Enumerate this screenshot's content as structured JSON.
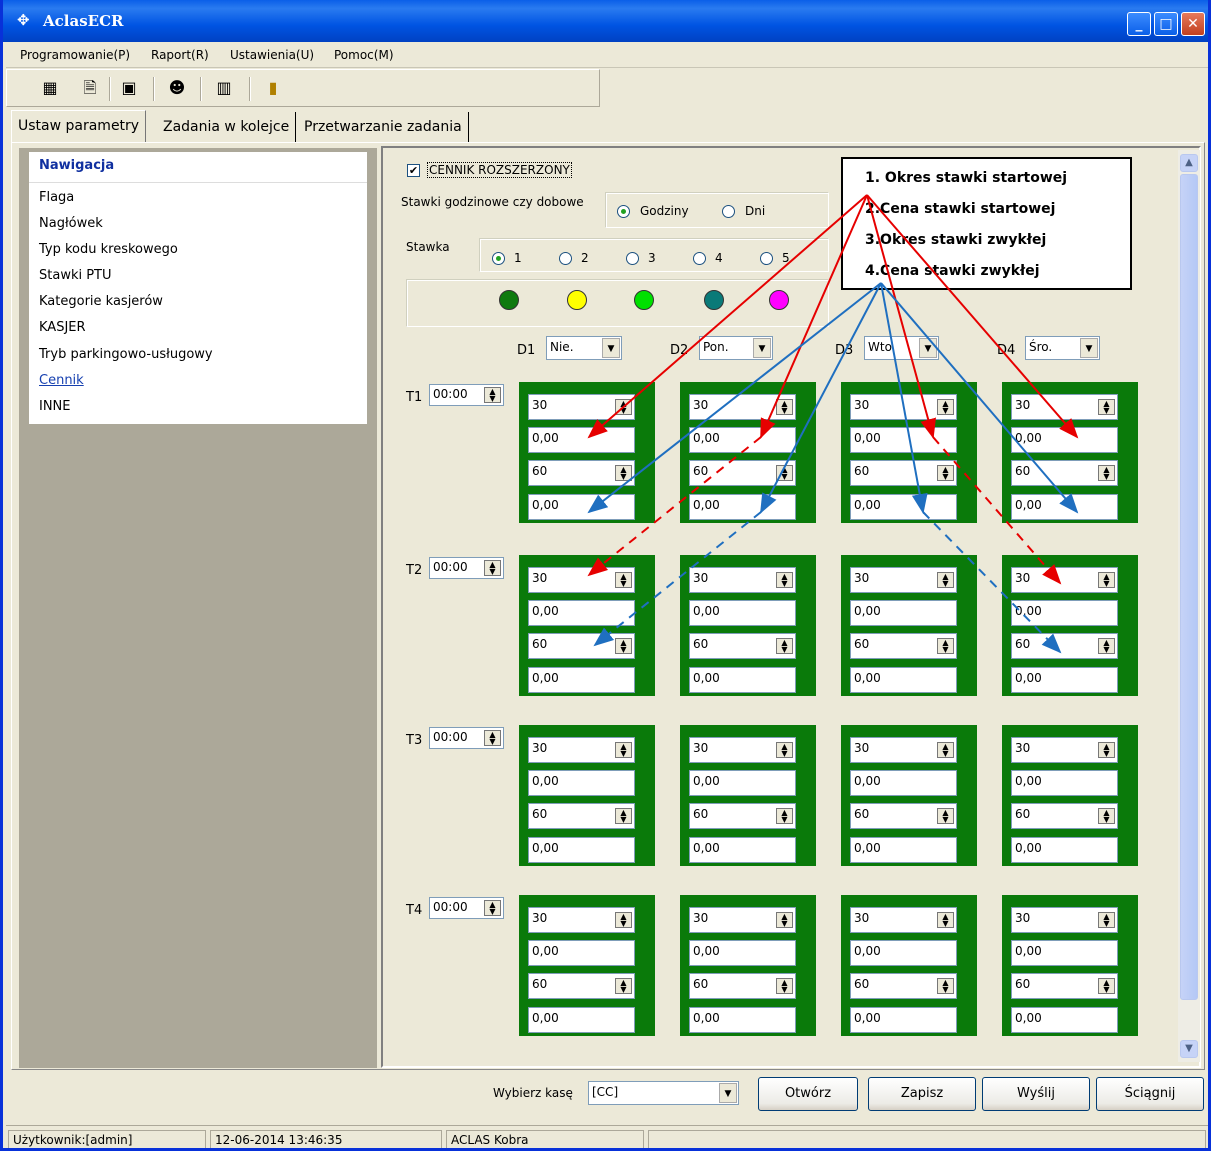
{
  "window": {
    "title": "AclasECR"
  },
  "menu": [
    "Programowanie(P)",
    "Raport(R)",
    "Ustawienia(U)",
    "Pomoc(M)"
  ],
  "toolbar_icons": [
    "table-icon",
    "document-icon",
    "monitor-icon",
    "users-icon",
    "building-icon",
    "exit-icon"
  ],
  "tabs": [
    "Ustaw parametry",
    "Zadania w kolejce",
    "Przetwarzanie zadania"
  ],
  "nav": {
    "title": "Nawigacja",
    "items": [
      "Flaga",
      "Nagłówek",
      "Typ kodu kreskowego",
      "Stawki PTU",
      "Kategorie kasjerów",
      "KASJER",
      "Tryb parkingowo-usługowy",
      "Cennik",
      "INNE"
    ],
    "selected": "Cennik"
  },
  "cennik": {
    "extended_label": "CENNIK ROZSZERZONY",
    "extended_checked": true,
    "rate_type_label": "Stawki godzinowe czy dobowe",
    "rate_types": [
      "Godziny",
      "Dni"
    ],
    "rate_type_selected": "Godziny",
    "stawka_label": "Stawka",
    "stawki": [
      "1",
      "2",
      "3",
      "4",
      "5"
    ],
    "stawka_selected": "1",
    "dot_colors": [
      "#0f7a0f",
      "#ffff00",
      "#00e000",
      "#0a7a78",
      "#ff00ff"
    ],
    "days": [
      {
        "label": "D1",
        "value": "Nie."
      },
      {
        "label": "D2",
        "value": "Pon."
      },
      {
        "label": "D3",
        "value": "Wto"
      },
      {
        "label": "D4",
        "value": "Śro."
      }
    ],
    "times": [
      {
        "label": "T1",
        "value": "00:00"
      },
      {
        "label": "T2",
        "value": "00:00"
      },
      {
        "label": "T3",
        "value": "00:00"
      },
      {
        "label": "T4",
        "value": "00:00"
      }
    ],
    "card_values": [
      "30",
      "0,00",
      "60",
      "0,00"
    ]
  },
  "annotation": {
    "lines": [
      "1. Okres stawki startowej",
      "2.Cena stawki startowej",
      "3.Okres stawki zwykłej",
      "4.Cena stawki zwykłej"
    ],
    "colors": {
      "red": "#e60000",
      "blue": "#1f6fc0"
    }
  },
  "footer": {
    "register_label": "Wybierz kasę",
    "register_value": "[CC]",
    "buttons": [
      "Otwórz",
      "Zapisz",
      "Wyślij",
      "Ściągnij"
    ]
  },
  "status": {
    "user": "Użytkownik:[admin]",
    "datetime": "12-06-2014 13:46:35",
    "device": "ACLAS Kobra"
  }
}
